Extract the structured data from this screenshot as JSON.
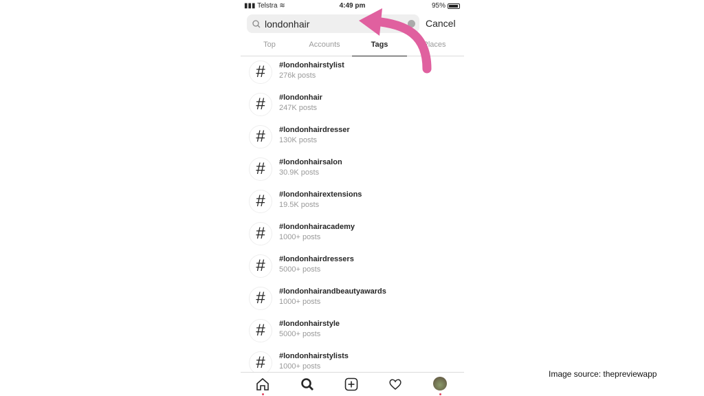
{
  "status": {
    "carrier": "Telstra",
    "time": "4:49 pm",
    "battery": "95%",
    "battery_level": 0.95
  },
  "search": {
    "value": "londonhair",
    "cancel": "Cancel"
  },
  "tabs": [
    "Top",
    "Accounts",
    "Tags",
    "Places"
  ],
  "active_tab": "Tags",
  "results": [
    {
      "tag": "#londonhairstylist",
      "posts": "276k posts"
    },
    {
      "tag": "#londonhair",
      "posts": "247K posts"
    },
    {
      "tag": "#londonhairdresser",
      "posts": "130K posts"
    },
    {
      "tag": "#londonhairsalon",
      "posts": "30.9K posts"
    },
    {
      "tag": "#londonhairextensions",
      "posts": "19.5K posts"
    },
    {
      "tag": "#londonhairacademy",
      "posts": "1000+ posts"
    },
    {
      "tag": "#londonhairdressers",
      "posts": "5000+ posts"
    },
    {
      "tag": "#londonhairandbeautyawards",
      "posts": "1000+ posts"
    },
    {
      "tag": "#londonhairstyle",
      "posts": "5000+ posts"
    },
    {
      "tag": "#londonhairstylists",
      "posts": "1000+ posts"
    }
  ],
  "nav": [
    "home-icon",
    "search-icon",
    "add-post-icon",
    "heart-icon",
    "profile-avatar"
  ],
  "annotation_color": "#e0609f",
  "credit": "Image source: thepreviewapp"
}
